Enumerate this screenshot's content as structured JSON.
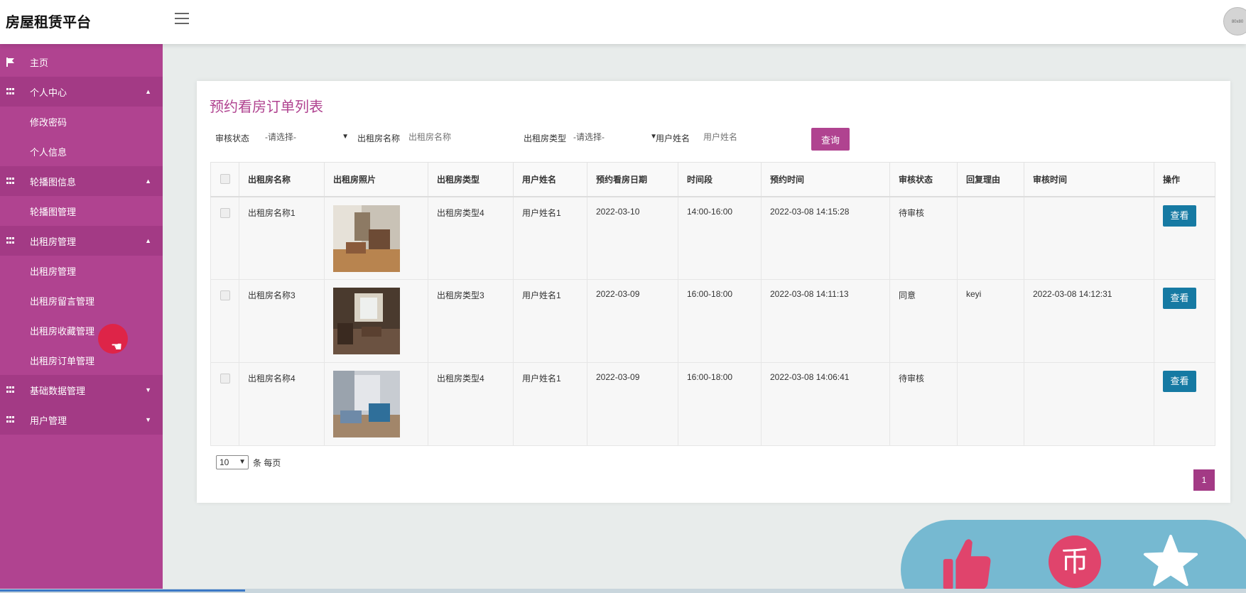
{
  "app": {
    "title": "房屋租赁平台"
  },
  "header": {
    "avatar_text": "80x80"
  },
  "sidebar": {
    "home": "主页",
    "groups": [
      {
        "label": "个人中心",
        "children": [
          "修改密码",
          "个人信息"
        ]
      },
      {
        "label": "轮播图信息",
        "children": [
          "轮播图管理"
        ]
      },
      {
        "label": "出租房管理",
        "children": [
          "出租房管理",
          "出租房留言管理",
          "出租房收藏管理",
          "出租房订单管理"
        ]
      },
      {
        "label": "基础数据管理",
        "children": []
      },
      {
        "label": "用户管理",
        "children": []
      }
    ]
  },
  "page": {
    "title": "预约看房订单列表",
    "filters": {
      "status_label": "审核状态",
      "status_value": "-请选择-",
      "name_label": "出租房名称",
      "name_placeholder": "出租房名称",
      "type_label": "出租房类型",
      "type_value": "-请选择-",
      "user_label": "用户姓名",
      "user_placeholder": "用户姓名",
      "query_button": "查询"
    },
    "table": {
      "headers": [
        "出租房名称",
        "出租房照片",
        "出租房类型",
        "用户姓名",
        "预约看房日期",
        "时间段",
        "预约时间",
        "审核状态",
        "回复理由",
        "审核时间",
        "操作"
      ],
      "rows": [
        {
          "name": "出租房名称1",
          "type": "出租房类型4",
          "user": "用户姓名1",
          "date": "2022-03-10",
          "slot": "14:00-16:00",
          "booked": "2022-03-08 14:15:28",
          "status": "待审核",
          "reason": "",
          "review_time": "",
          "action": "查看"
        },
        {
          "name": "出租房名称3",
          "type": "出租房类型3",
          "user": "用户姓名1",
          "date": "2022-03-09",
          "slot": "16:00-18:00",
          "booked": "2022-03-08 14:11:13",
          "status": "同意",
          "reason": "keyi",
          "review_time": "2022-03-08 14:12:31",
          "action": "查看"
        },
        {
          "name": "出租房名称4",
          "type": "出租房类型4",
          "user": "用户姓名1",
          "date": "2022-03-09",
          "slot": "16:00-18:00",
          "booked": "2022-03-08 14:06:41",
          "status": "待审核",
          "reason": "",
          "review_time": "",
          "action": "查看"
        }
      ]
    },
    "pagination": {
      "page_size": "10",
      "page_size_suffix": "条 每页",
      "current_page": "1"
    }
  },
  "colors": {
    "primary": "#b04390",
    "view_button": "#167aa3"
  },
  "float_bar": {
    "icons": [
      "thumbs-up-icon",
      "coin-icon",
      "star-icon"
    ],
    "coin_glyph": "币"
  }
}
